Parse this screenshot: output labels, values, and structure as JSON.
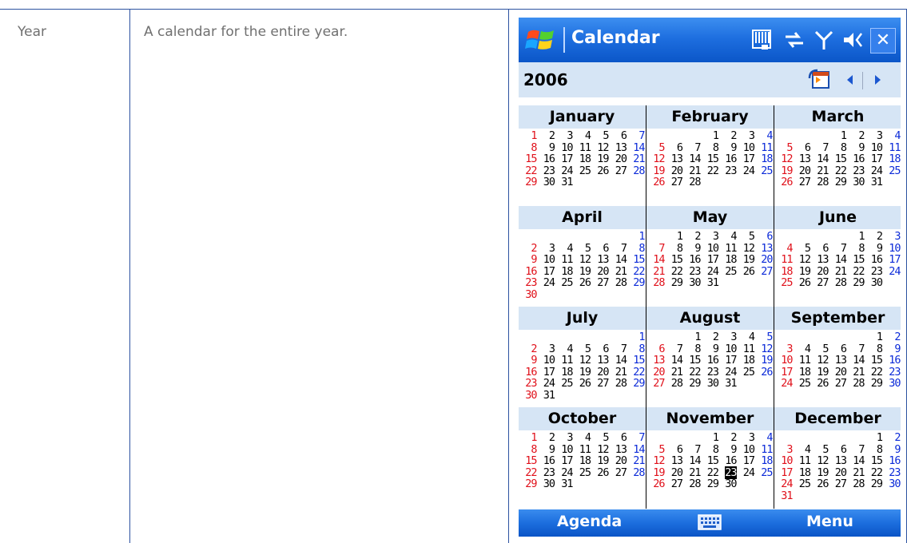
{
  "doc": {
    "label": "Year",
    "description": "A calendar for the entire year."
  },
  "device": {
    "title": "Calendar",
    "close_label": "✕",
    "year": "2006",
    "soft_left": "Agenda",
    "soft_right": "Menu",
    "today": {
      "month": 10,
      "day": 23
    },
    "months": [
      {
        "name": "January",
        "start": 0,
        "days": 31
      },
      {
        "name": "February",
        "start": 3,
        "days": 28
      },
      {
        "name": "March",
        "start": 3,
        "days": 31
      },
      {
        "name": "April",
        "start": 6,
        "days": 30
      },
      {
        "name": "May",
        "start": 1,
        "days": 31
      },
      {
        "name": "June",
        "start": 4,
        "days": 30
      },
      {
        "name": "July",
        "start": 6,
        "days": 31
      },
      {
        "name": "August",
        "start": 2,
        "days": 31
      },
      {
        "name": "September",
        "start": 5,
        "days": 30
      },
      {
        "name": "October",
        "start": 0,
        "days": 31
      },
      {
        "name": "November",
        "start": 3,
        "days": 30
      },
      {
        "name": "December",
        "start": 5,
        "days": 31
      }
    ],
    "colors": {
      "sunday": "#e0101a",
      "saturday": "#0b2ad8",
      "header_bg": "#d6e5f5",
      "title_blue": "#1e6fe0"
    },
    "icons": [
      "windows-logo-icon",
      "sync-icon",
      "antenna-icon",
      "volume-icon",
      "close-icon",
      "today-icon",
      "prev-arrow-icon",
      "next-arrow-icon",
      "keyboard-icon"
    ]
  }
}
